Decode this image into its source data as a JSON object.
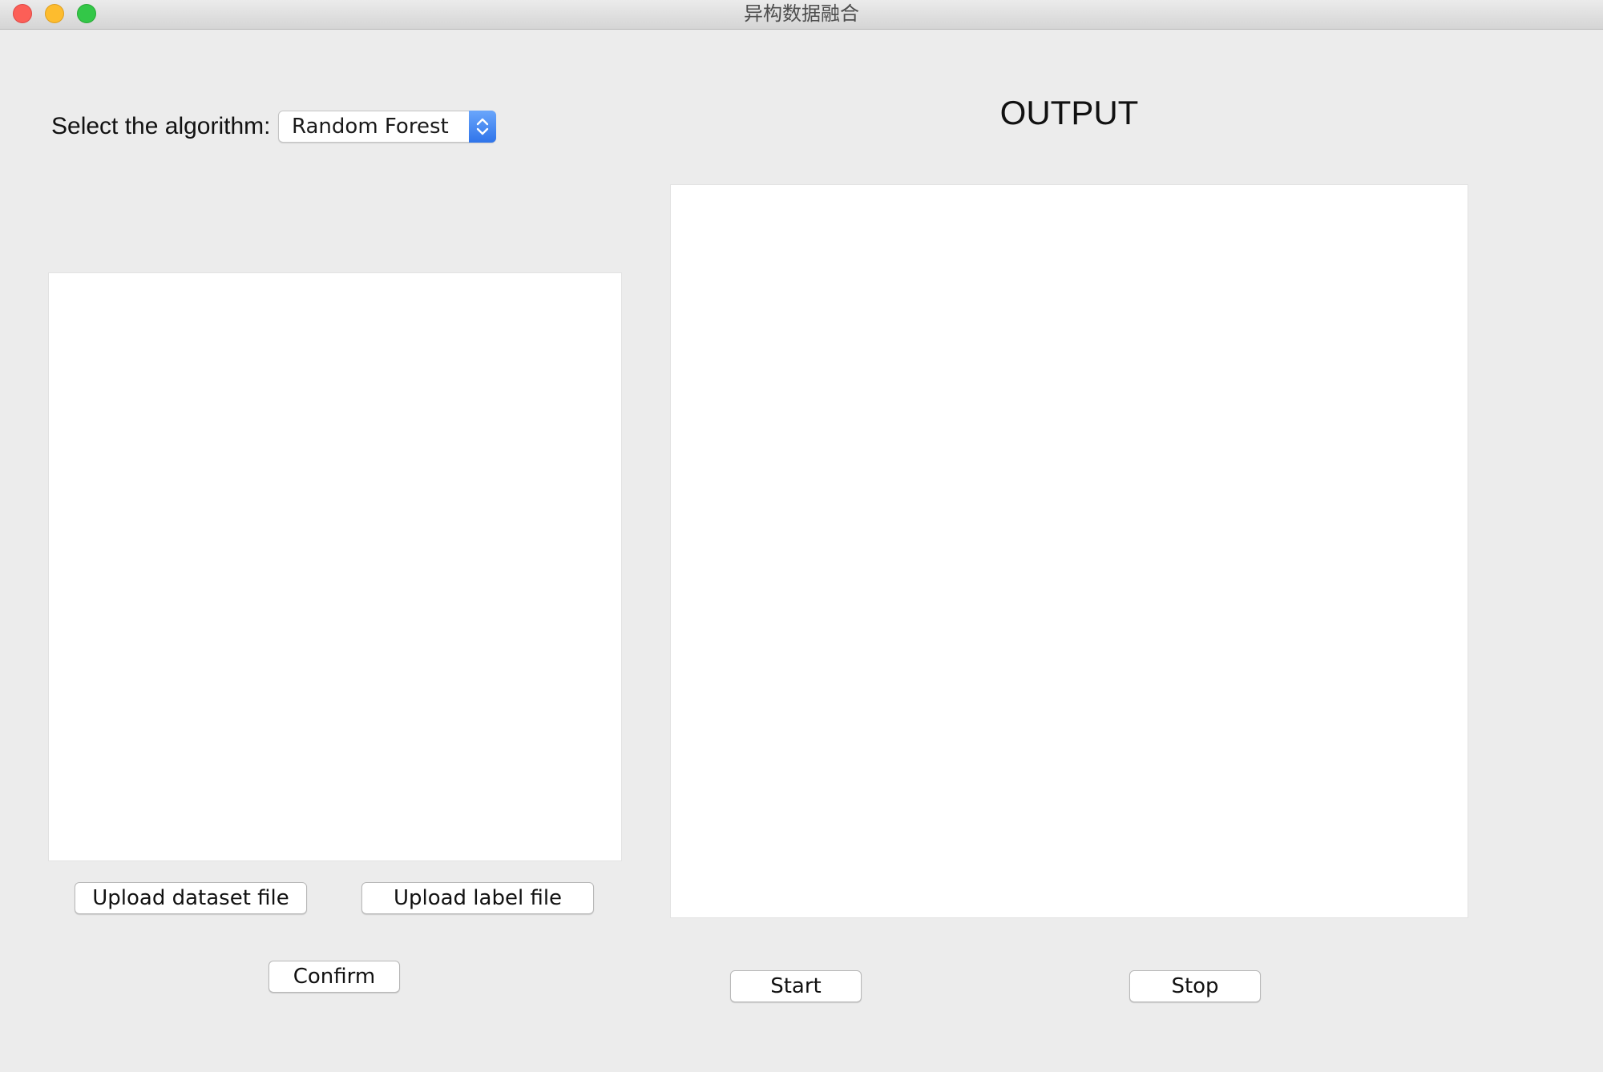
{
  "window": {
    "title": "异构数据融合"
  },
  "algorithm": {
    "label": "Select the algorithm:",
    "selected": "Random Forest"
  },
  "output": {
    "title": "OUTPUT"
  },
  "buttons": {
    "upload_dataset": "Upload dataset file",
    "upload_label": "Upload label file",
    "confirm": "Confirm",
    "start": "Start",
    "stop": "Stop"
  },
  "icons": {
    "close": "close-icon",
    "minimize": "minimize-icon",
    "maximize": "maximize-icon",
    "select_stepper": "chevron-up-down-icon"
  },
  "colors": {
    "accent": "#2f74ea",
    "close": "#fc5f57",
    "minimize": "#fdbc2e",
    "maximize": "#33c748",
    "window_bg": "#ececec"
  }
}
